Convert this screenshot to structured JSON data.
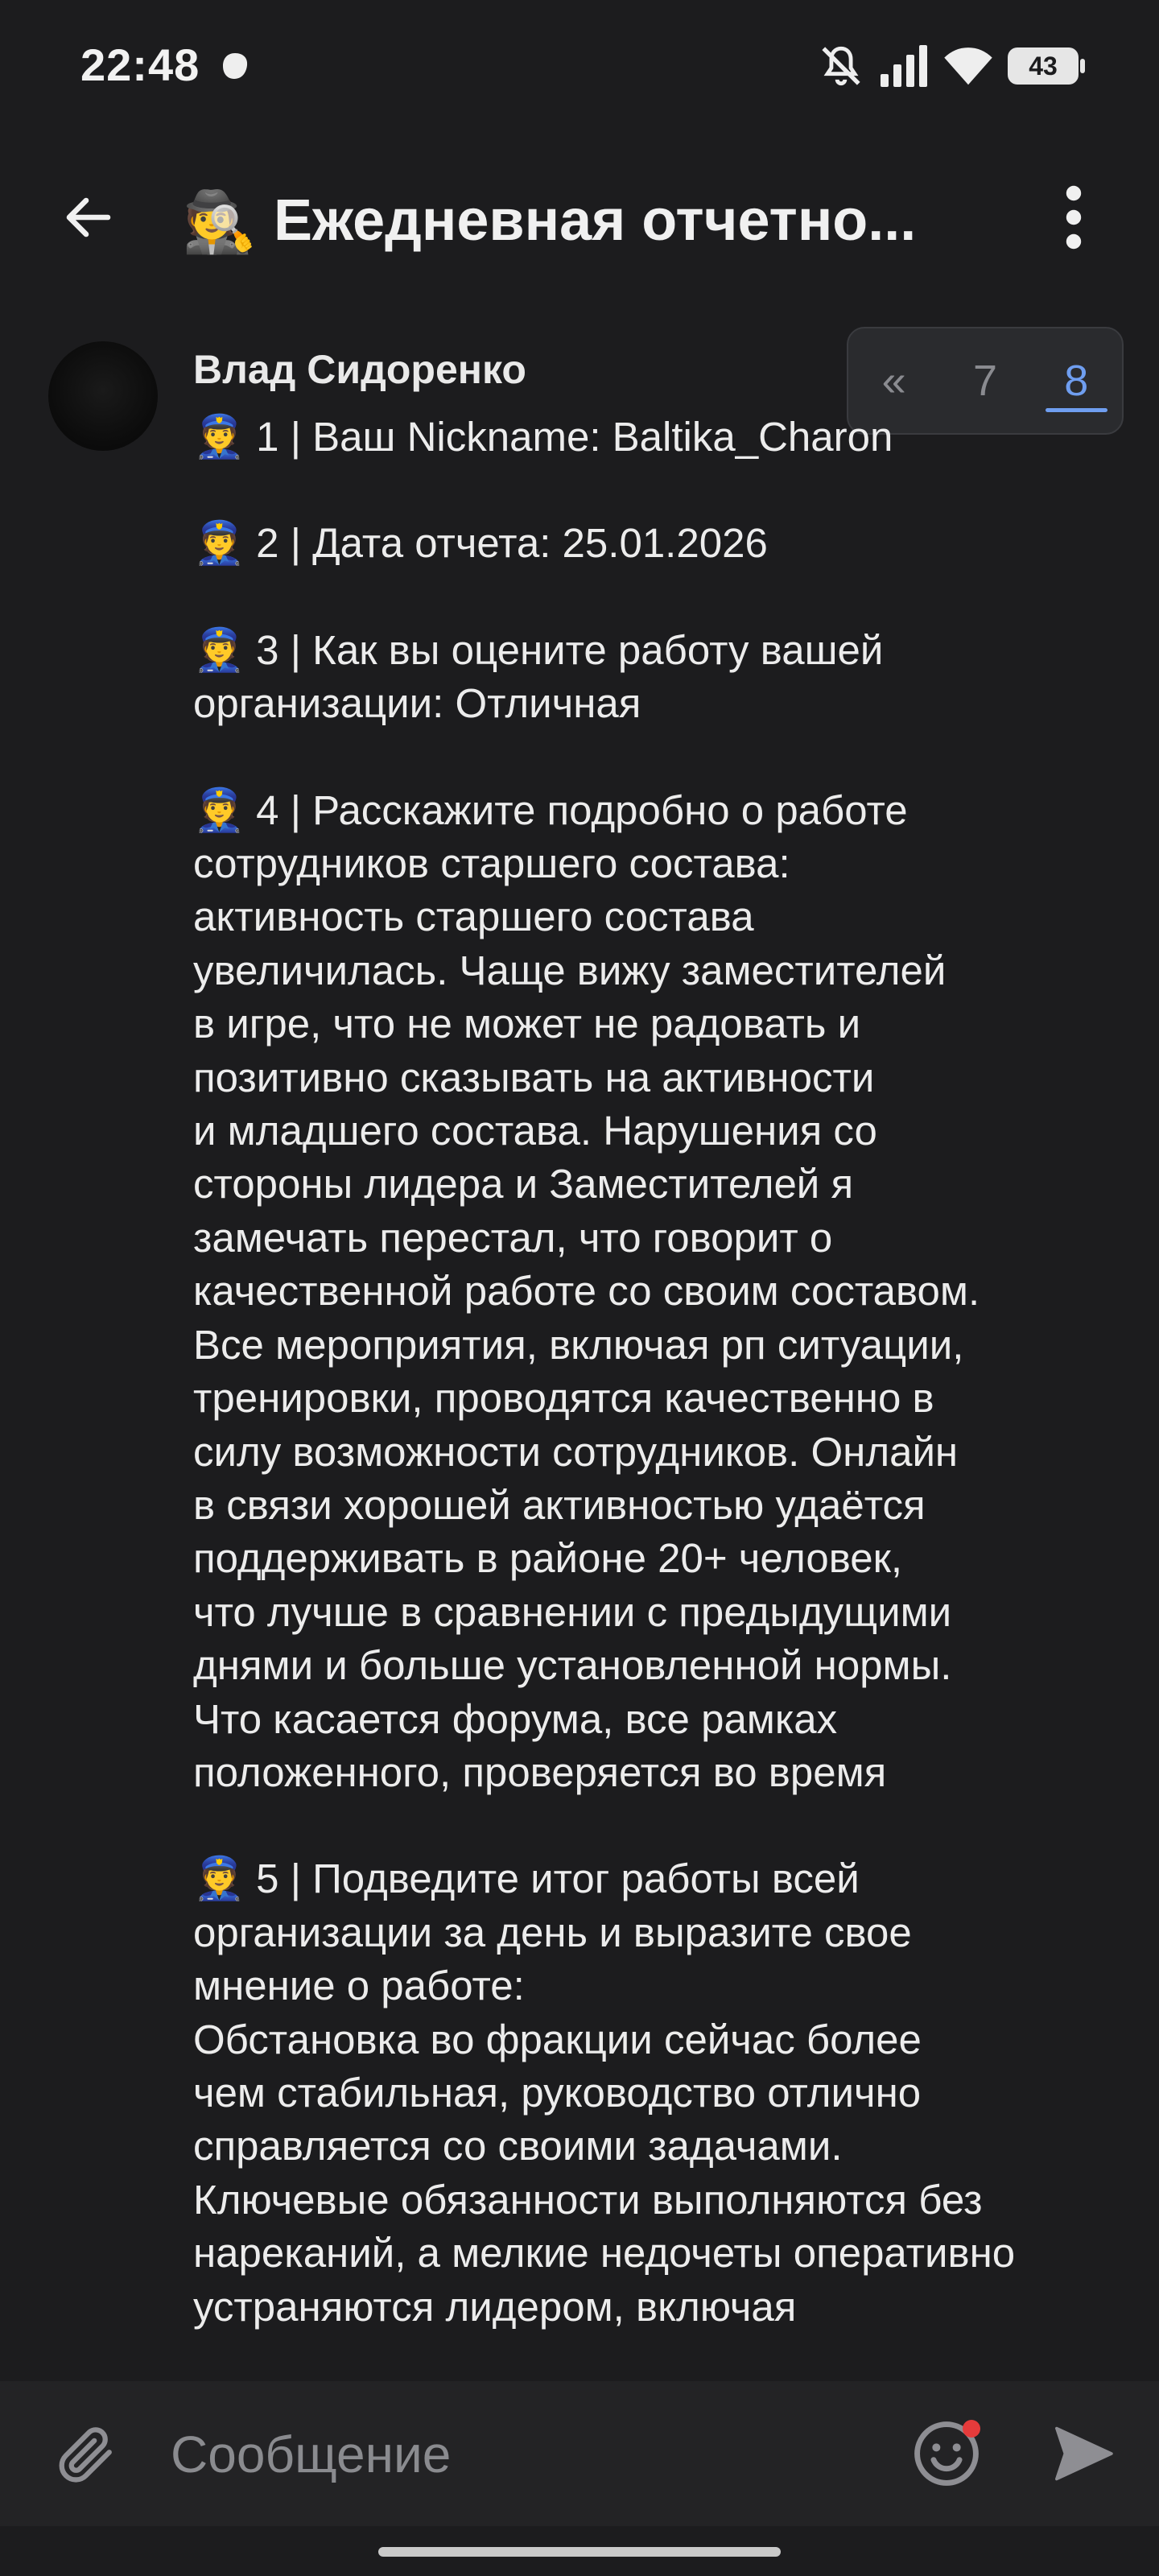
{
  "status_bar": {
    "time": "22:48",
    "battery": "43",
    "icons": [
      "mute-bell-icon",
      "signal-icon",
      "wifi-icon",
      "battery-icon"
    ]
  },
  "header": {
    "title_emoji": "🕵️",
    "title": "Ежедневная отчетно..."
  },
  "message": {
    "author": "Влад Сидоренко",
    "emoji": "👮",
    "items": [
      {
        "lines": [
          "1 | Ваш Nickname: Baltika_Charon"
        ]
      },
      {
        "lines": [
          "2 | Дата отчета: 25.01.2026"
        ]
      },
      {
        "lines": [
          "3 | Как вы оцените работу вашей",
          "организации: Отличная"
        ]
      },
      {
        "lines": [
          "4 | Расскажите подробно о работе",
          "сотрудников старшего состава:",
          "активность старшего состава",
          "увеличилась. Чаще вижу заместителей",
          "в игре, что не может не радовать и",
          "позитивно сказывать на активности",
          "и младшего состава. Нарушения со",
          "стороны лидера и Заместителей я",
          "замечать перестал, что говорит о",
          "качественной работе со своим составом.",
          "Все мероприятия, включая рп ситуации,",
          "тренировки, проводятся качественно в",
          "силу возможности сотрудников. Онлайн",
          "в связи хорошей активностью удаётся",
          "поддерживать в районе 20+ человек,",
          "что лучше в сравнении с предыдущими",
          "днями и больше установленной нормы.",
          "Что касается форума, все рамках",
          "положенного, проверяется во время"
        ]
      },
      {
        "lines": [
          "5 | Подведите итог работы всей",
          "организации за день и выразите свое",
          "мнение о работе:",
          "Обстановка во фракции сейчас более",
          "чем стабильная, руководство отлично",
          "справляется со своими задачами.",
          "Ключевые обязанности выполняются без",
          "нареканий, а мелкие недочеты оперативно",
          "устраняются лидером, включая"
        ]
      }
    ]
  },
  "page_switcher": {
    "prev": "«",
    "pages": [
      "7",
      "8"
    ],
    "active_page": "8"
  },
  "input": {
    "placeholder": "Сообщение",
    "value": ""
  },
  "colors": {
    "background": "#1c1c1e",
    "input_bar": "#232325",
    "accent": "#6f9ef0",
    "notification_dot": "#e53b3b"
  }
}
